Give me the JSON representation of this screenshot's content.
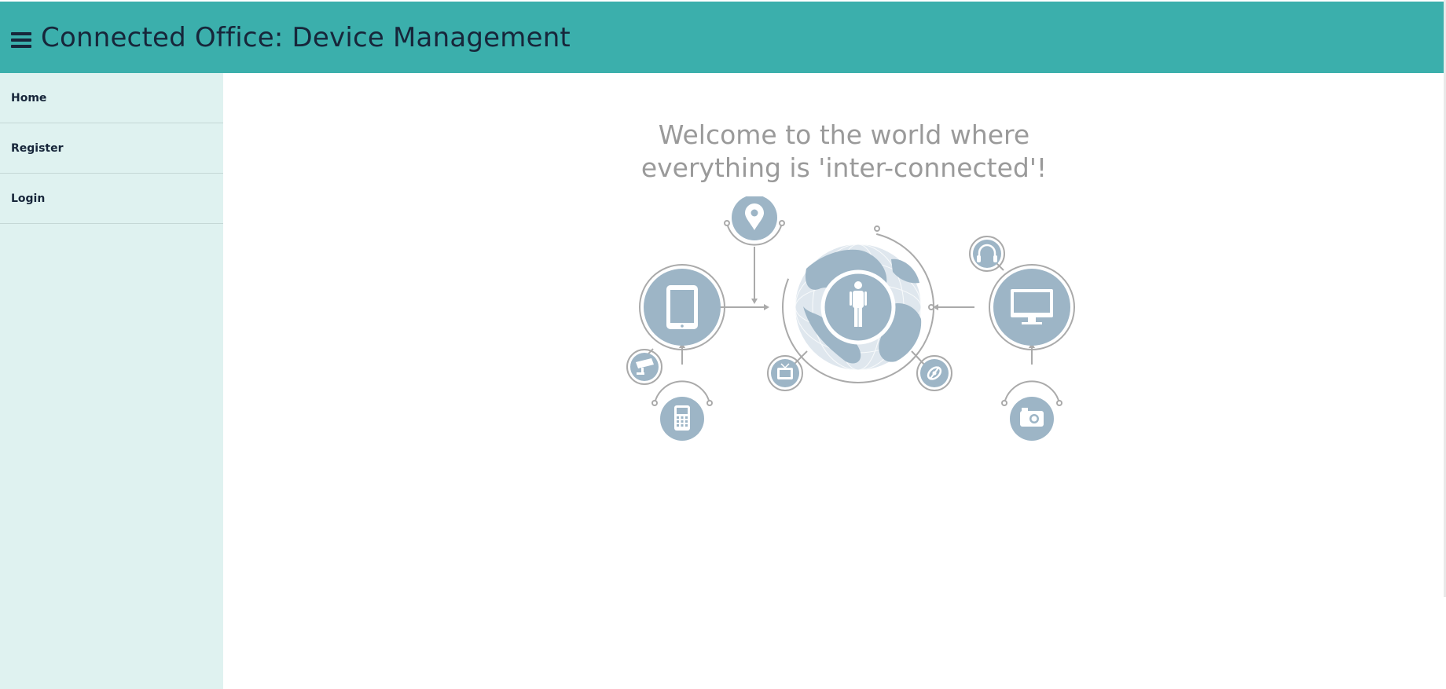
{
  "header": {
    "title": "Connected Office: Device Management",
    "menu_icon": "hamburger-menu-icon",
    "background": "#3bafac"
  },
  "sidebar": {
    "background": "#dff2f0",
    "items": [
      {
        "label": "Home"
      },
      {
        "label": "Register"
      },
      {
        "label": "Login"
      }
    ]
  },
  "main": {
    "welcome_line1": "Welcome to the world where",
    "welcome_line2": "everything is 'inter-connected'!",
    "illustration": {
      "icons": [
        "person-icon",
        "globe-icon",
        "tablet-icon",
        "monitor-icon",
        "location-pin-icon",
        "security-camera-icon",
        "mobile-phone-icon",
        "tv-icon",
        "satellite-icon",
        "headphones-icon",
        "camera-icon"
      ],
      "icon_color": "#9db5c6",
      "line_color": "#aaaaaa"
    }
  }
}
